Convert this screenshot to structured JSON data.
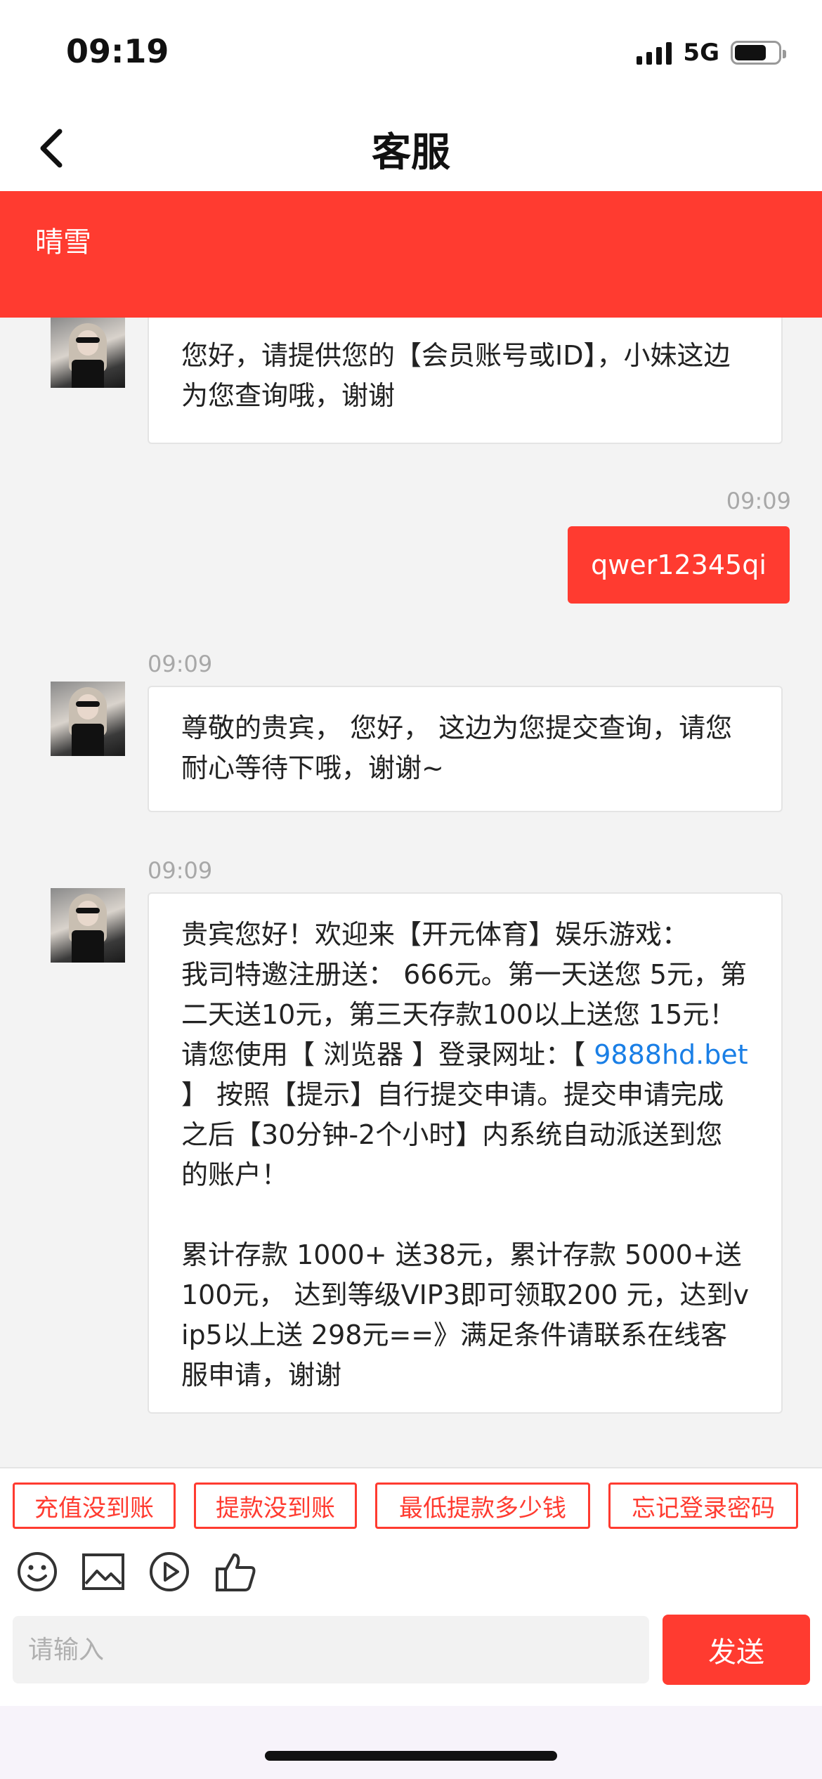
{
  "status_bar": {
    "time": "09:19",
    "network": "5G",
    "battery_level": 0.74
  },
  "nav": {
    "title": "客服",
    "back_icon": "chevron-left-icon"
  },
  "agent": {
    "name": "晴雪"
  },
  "messages": [
    {
      "from": "agent",
      "text": "您好，请提供您的【会员账号或ID】，小妹这边为您查询哦，谢谢"
    },
    {
      "from": "user",
      "time": "09:09",
      "text": "qwer12345qi"
    },
    {
      "from": "agent",
      "time": "09:09",
      "text": "尊敬的贵宾， 您好， 这边为您提交查询，请您耐心等待下哦，谢谢~"
    },
    {
      "from": "agent",
      "time": "09:09",
      "text_before_link": "贵宾您好！欢迎来【开元体育】娱乐游戏：\n我司特邀注册送： 666元。第一天送您 5元，第二天送10元，第三天存款100以上送您 15元！请您使用【 浏览器 】登录网址：【 ",
      "link": "9888hd.bet",
      "text_after_link": " 】 按照【提示】自行提交申请。提交申请完成之后【30分钟-2个小时】内系统自动派送到您的账户！\n\n累计存款 1000+ 送38元，累计存款 5000+送100元， 达到等级VIP3即可领取200 元，达到vip5以上送 298元==》满足条件请联系在线客服申请，谢谢"
    }
  ],
  "quick_replies": [
    "充值没到账",
    "提款没到账",
    "最低提款多少钱",
    "忘记登录密码"
  ],
  "toolbar_icons": [
    "emoji-icon",
    "image-icon",
    "video-icon",
    "thumbs-up-icon"
  ],
  "composer": {
    "placeholder": "请输入",
    "send_label": "发送"
  },
  "colors": {
    "accent": "#ff3b30",
    "link": "#1a7fe6",
    "background": "#f3f3f3"
  }
}
